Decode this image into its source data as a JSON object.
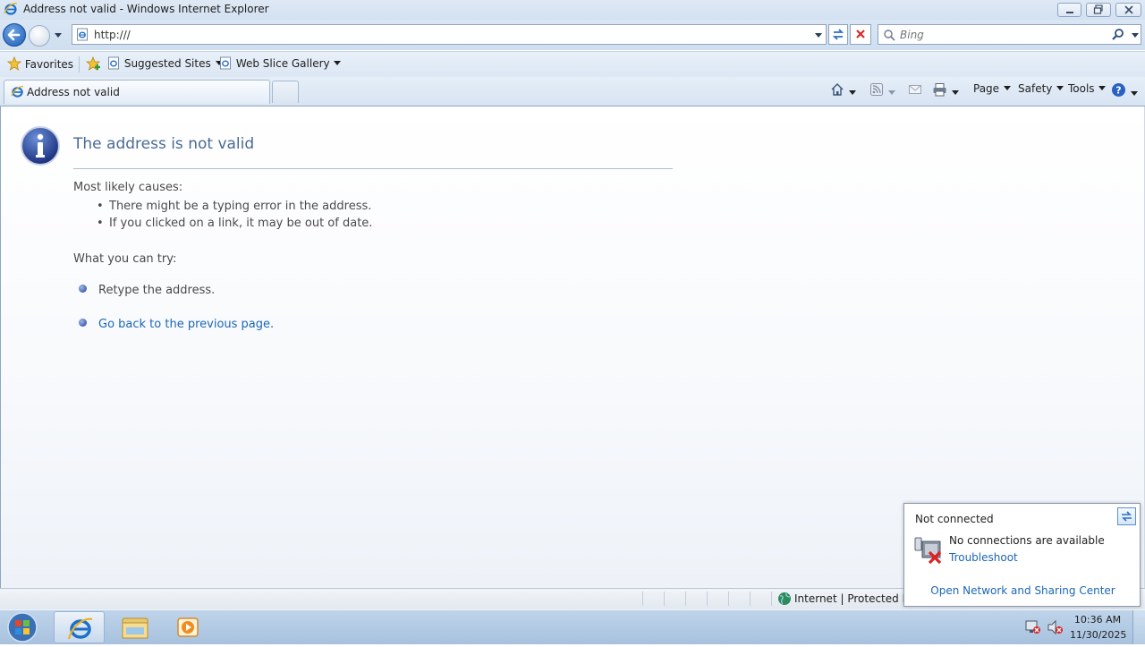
{
  "window": {
    "title": "Address not valid - Windows Internet Explorer"
  },
  "address_bar": {
    "url": "http:///"
  },
  "search": {
    "placeholder": "Bing"
  },
  "favorites_bar": {
    "favorites_label": "Favorites",
    "suggested_sites_label": "Suggested Sites",
    "web_slice_gallery_label": "Web Slice Gallery"
  },
  "tabs": [
    {
      "label": "Address not valid"
    }
  ],
  "command_bar": {
    "page_label": "Page",
    "safety_label": "Safety",
    "tools_label": "Tools"
  },
  "error_page": {
    "heading": "The address is not valid",
    "causes_title": "Most likely causes:",
    "causes": [
      "There might be a typing error in the address.",
      "If you clicked on a link, it may be out of date."
    ],
    "try_title": "What you can try:",
    "retype": "Retype the address.",
    "go_back_link": "Go back to the previous page."
  },
  "status_bar": {
    "zone_text": "Internet | Protected Mo"
  },
  "network_popup": {
    "title": "Not connected",
    "message": "No connections are available",
    "troubleshoot_link": "Troubleshoot",
    "network_center_link": "Open Network and Sharing Center"
  },
  "taskbar": {
    "time": "10:36 AM",
    "date": "11/30/2025"
  },
  "colors": {
    "link": "#1b67b5",
    "heading": "#4a6a94"
  }
}
